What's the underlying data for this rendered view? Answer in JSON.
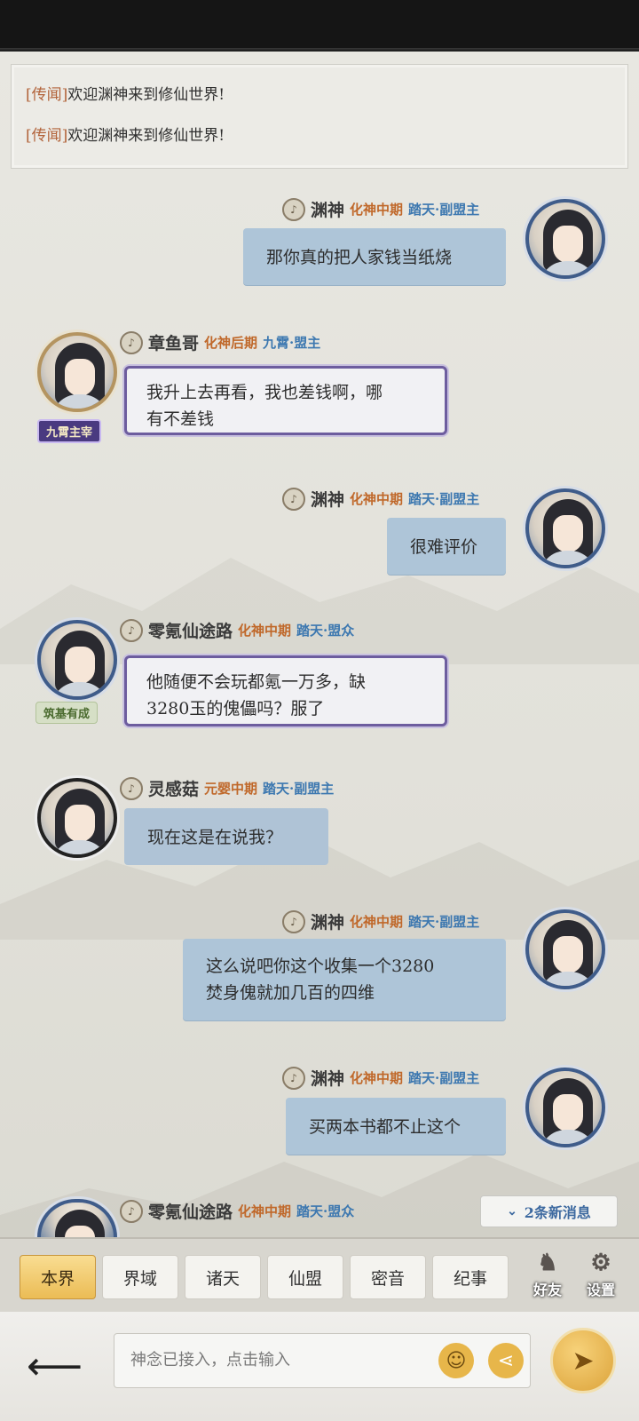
{
  "announcements": [
    {
      "tag": "[传闻]",
      "text": "欢迎渊神来到修仙世界!"
    },
    {
      "tag": "[传闻]",
      "text": "欢迎渊神来到修仙世界!"
    }
  ],
  "messages": [
    {
      "nick": "渊神",
      "rank": "化神中期",
      "title": "踏天·副盟主",
      "text": "那你真的把人家钱当纸烧"
    },
    {
      "nick": "章鱼哥",
      "rank": "化神后期",
      "title": "九霄·盟主",
      "text_lines": [
        "我升上去再看，我也差钱啊，哪",
        "有不差钱"
      ],
      "badge": "九霄主宰"
    },
    {
      "nick": "渊神",
      "rank": "化神中期",
      "title": "踏天·副盟主",
      "text": "很难评价"
    },
    {
      "nick": "零氪仙途路",
      "rank": "化神中期",
      "title": "踏天·盟众",
      "text_lines": [
        "他随便不会玩都氪一万多，缺",
        "3280玉的傀儡吗？服了"
      ],
      "badge": "筑基有成"
    },
    {
      "nick": "灵感菇",
      "rank": "元婴中期",
      "title": "踏天·副盟主",
      "text": "现在这是在说我？"
    },
    {
      "nick": "渊神",
      "rank": "化神中期",
      "title": "踏天·副盟主",
      "text_lines": [
        "这么说吧你这个收集一个3280",
        "焚身傀就加几百的四维"
      ]
    },
    {
      "nick": "渊神",
      "rank": "化神中期",
      "title": "踏天·副盟主",
      "text": "买两本书都不止这个"
    },
    {
      "nick": "零氪仙途路",
      "rank": "化神中期",
      "title": "踏天·盟众"
    }
  ],
  "new_messages": "2条新消息",
  "tabs": [
    "本界",
    "界域",
    "诸天",
    "仙盟",
    "密音",
    "纪事"
  ],
  "tools": {
    "friends": "好友",
    "settings": "设置"
  },
  "input": {
    "placeholder": "神念已接入，点击输入"
  },
  "icons": {
    "voice": "voice-icon",
    "back": "back-arrow-icon",
    "emoji": "emoji-icon",
    "share": "share-icon",
    "send": "send-icon"
  },
  "colors": {
    "accent": "#ebbc55",
    "bubble_mine": "#aec5d8",
    "rank": "#c0682a",
    "title": "#3d78b0"
  }
}
